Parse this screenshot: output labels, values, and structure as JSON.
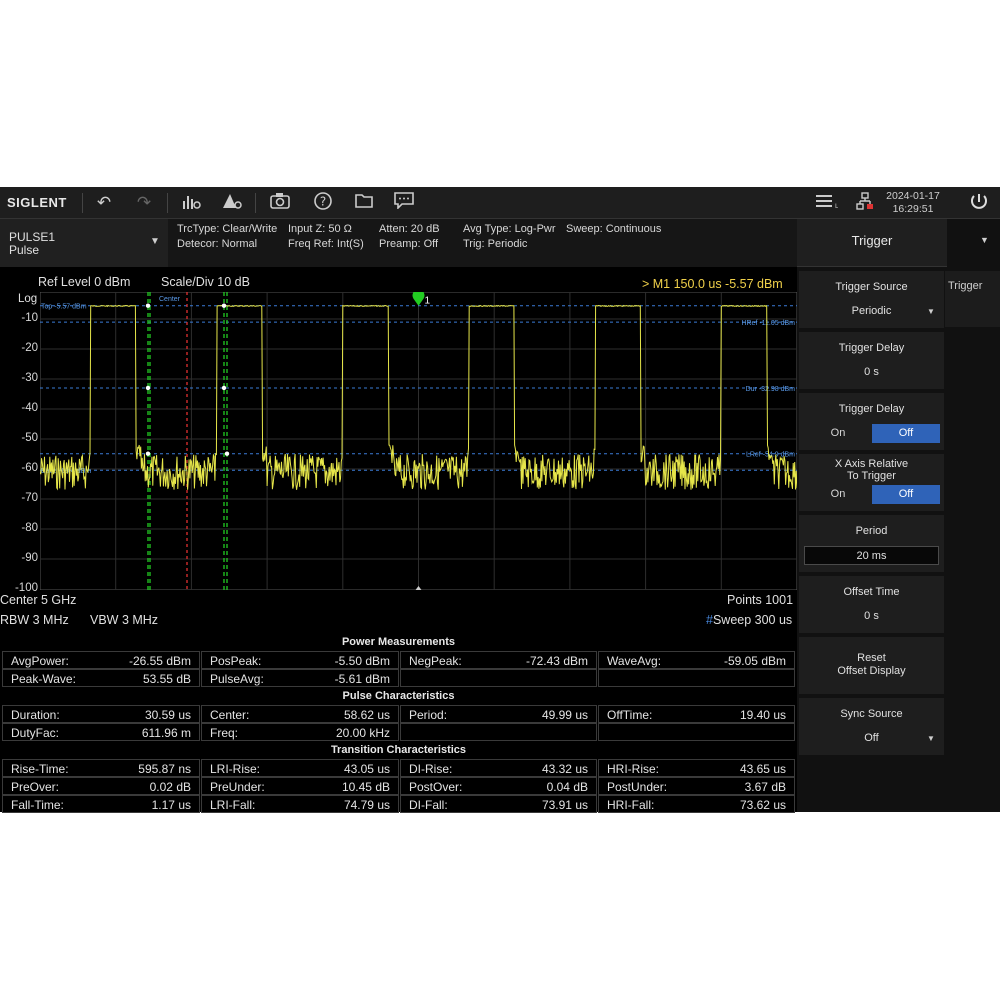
{
  "toolbar": {
    "logo": "SIGLENT",
    "date": "2024-01-17",
    "time": "16:29:51"
  },
  "trace_selector": {
    "name": "PULSE1",
    "mode": "Pulse"
  },
  "info": {
    "trc_type": "TrcType: Clear/Write",
    "detector": "Detecor: Normal",
    "input_z": "Input Z: 50 Ω",
    "freq_ref": "Freq Ref: Int(S)",
    "atten": "Atten: 20 dB",
    "preamp": "Preamp: Off",
    "avg_type": "Avg Type: Log-Pwr",
    "sweep": "Sweep: Continuous",
    "trig": "Trig: Periodic"
  },
  "plot": {
    "ref_level": "Ref Level  0 dBm",
    "scale_div": "Scale/Div  10 dB",
    "marker_readout": "> M1   150.0 us  -5.57 dBm",
    "log_label": "Log",
    "center": "Center  5 GHz",
    "points": "Points  1001",
    "rbw": "RBW  3 MHz",
    "vbw": "VBW  3 MHz",
    "sweep_hash": "#",
    "sweep": "Sweep  300 us"
  },
  "chart_data": {
    "type": "line",
    "y_unit": "dBm",
    "ylim": [
      -100,
      0
    ],
    "x_unit": "us",
    "xlim": [
      0,
      300
    ],
    "y_ticks": [
      "-10",
      "-20",
      "-30",
      "-40",
      "-50",
      "-60",
      "-70",
      "-80",
      "-90",
      "-100"
    ],
    "grid": true,
    "pulse_high_dbm": -5.5,
    "noise_floor_dbm": -60,
    "pulses_us": [
      [
        20,
        38
      ],
      [
        70,
        88
      ],
      [
        120,
        138
      ],
      [
        170,
        188
      ],
      [
        220,
        238
      ],
      [
        270,
        288
      ]
    ],
    "reference_lines": [
      {
        "label": "Top -5.57 dBm",
        "value": -5.57
      },
      {
        "label": "HRef -11.05 dBm",
        "value": -11.05
      },
      {
        "label": "Dur -32.98 dBm",
        "value": -32.98
      },
      {
        "label": "Base -60.4 dBm",
        "value": -60.4
      },
      {
        "label": "LRef -54.9 dBm",
        "value": -54.9
      }
    ],
    "center_label": "Center",
    "marker": {
      "label": "1",
      "x_us": 150.0,
      "y_dbm": -5.57
    }
  },
  "measurements": {
    "power_title": "Power Measurements",
    "pulse_title": "Pulse Characteristics",
    "transition_title": "Transition Characteristics",
    "power": [
      [
        [
          "AvgPower:",
          "-26.55 dBm"
        ],
        [
          "PosPeak:",
          "-5.50 dBm"
        ],
        [
          "NegPeak:",
          "-72.43 dBm"
        ],
        [
          "WaveAvg:",
          "-59.05 dBm"
        ]
      ],
      [
        [
          "Peak-Wave:",
          "53.55 dB"
        ],
        [
          "PulseAvg:",
          "-5.61 dBm"
        ],
        [
          "",
          ""
        ],
        [
          "",
          ""
        ]
      ]
    ],
    "pulse": [
      [
        [
          "Duration:",
          "30.59 us"
        ],
        [
          "Center:",
          "58.62 us"
        ],
        [
          "Period:",
          "49.99 us"
        ],
        [
          "OffTime:",
          "19.40 us"
        ]
      ],
      [
        [
          "DutyFac:",
          "611.96 m"
        ],
        [
          "Freq:",
          "20.00 kHz"
        ],
        [
          "",
          ""
        ],
        [
          "",
          ""
        ]
      ]
    ],
    "transition": [
      [
        [
          "Rise-Time:",
          "595.87 ns"
        ],
        [
          "LRI-Rise:",
          "43.05 us"
        ],
        [
          "DI-Rise:",
          "43.32 us"
        ],
        [
          "HRI-Rise:",
          "43.65 us"
        ]
      ],
      [
        [
          "PreOver:",
          "0.02 dB"
        ],
        [
          "PreUnder:",
          "10.45 dB"
        ],
        [
          "PostOver:",
          "0.04 dB"
        ],
        [
          "PostUnder:",
          "3.67 dB"
        ]
      ],
      [
        [
          "Fall-Time:",
          "1.17 us"
        ],
        [
          "LRI-Fall:",
          "74.79 us"
        ],
        [
          "DI-Fall:",
          "73.91 us"
        ],
        [
          "HRI-Fall:",
          "73.62 us"
        ]
      ]
    ]
  },
  "panel": {
    "title": "Trigger",
    "tab": "Trigger",
    "trigger_source": {
      "label": "Trigger Source",
      "value": "Periodic"
    },
    "trigger_delay_value": {
      "label": "Trigger Delay",
      "value": "0 s"
    },
    "trigger_delay_toggle": {
      "label": "Trigger Delay",
      "on": "On",
      "off": "Off"
    },
    "x_axis_relative": {
      "label1": "X Axis Relative",
      "label2": "To Trigger",
      "on": "On",
      "off": "Off"
    },
    "period": {
      "label": "Period",
      "value": "20 ms"
    },
    "offset_time": {
      "label": "Offset Time",
      "value": "0 s"
    },
    "reset_offset": {
      "label1": "Reset",
      "label2": "Offset Display"
    },
    "sync_source": {
      "label": "Sync Source",
      "value": "Off"
    }
  },
  "colors": {
    "trace": "#e6e64a",
    "ref_line": "#3a7bd5",
    "marker": "#22cc22",
    "toggle_active": "#2f63b8"
  }
}
